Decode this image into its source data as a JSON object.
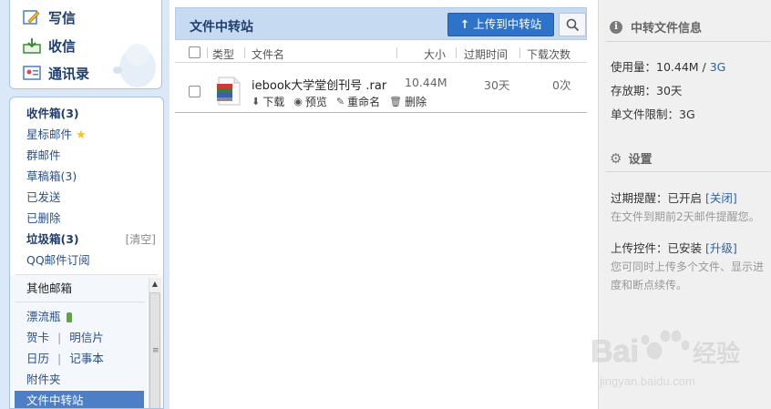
{
  "sidebar": {
    "compose": [
      {
        "label": "写信"
      },
      {
        "label": "收信"
      },
      {
        "label": "通讯录"
      }
    ],
    "folders": {
      "inbox": {
        "label": "收件箱",
        "count": "(3)"
      },
      "starred": {
        "label": "星标邮件"
      },
      "group": {
        "label": "群邮件"
      },
      "drafts": {
        "label": "草稿箱",
        "count": "(3)"
      },
      "sent": {
        "label": "已发送"
      },
      "deleted": {
        "label": "已删除"
      },
      "spam": {
        "label": "垃圾箱",
        "count": "(3)",
        "clear": "[清空]"
      },
      "subscription": {
        "label": "QQ邮件订阅"
      }
    },
    "other": {
      "title": "其他邮箱",
      "drift": "漂流瓶",
      "card": "贺卡",
      "pipe": "|",
      "postcard": "明信片",
      "calendar": "日历",
      "notes": "记事本",
      "attachments": "附件夹",
      "transfer": "文件中转站"
    }
  },
  "main": {
    "title": "文件中转站",
    "upload_button": "上传到中转站",
    "columns": {
      "type": "类型",
      "name": "文件名",
      "size": "大小",
      "expiry": "过期时间",
      "downloads": "下载次数"
    },
    "files": [
      {
        "name": "iebook大学堂创刊号 .rar",
        "size": "10.44M",
        "expiry": "30天",
        "downloads": "0次",
        "actions": {
          "download": "下载",
          "preview": "预览",
          "rename": "重命名",
          "delete": "删除"
        }
      }
    ]
  },
  "right": {
    "info_title": "中转文件信息",
    "usage_label": "使用量：10.44M / ",
    "usage_total": "3G",
    "retention": "存放期：30天",
    "file_limit": "单文件限制：3G",
    "settings_title": "设置",
    "expiry_reminder_label": "过期提醒：已开启 ",
    "expiry_reminder_link": "[关闭]",
    "expiry_reminder_note": "在文件到期前2天邮件提醒您。",
    "upload_control_label": "上传控件：已安装 ",
    "upload_control_link": "[升级]",
    "upload_control_note": "您可同时上传多个文件、显示进度和断点续传。"
  },
  "watermark": {
    "brand": "Bai",
    "brand2": "经验",
    "url": "jingyan.baidu.com"
  },
  "colors": {
    "accent": "#2f73c8",
    "sidebar_bg": "#dbe8f8",
    "header_bg": "#c6daf2",
    "selected": "#4d7fc6"
  },
  "icons": [
    "compose-icon",
    "inbox-icon",
    "contacts-icon",
    "star-icon",
    "bottle-icon",
    "upload-arrow-icon",
    "search-icon",
    "archive-file-icon",
    "download-icon",
    "eye-icon",
    "pencil-icon",
    "trash-icon",
    "info-icon",
    "gear-icon"
  ]
}
